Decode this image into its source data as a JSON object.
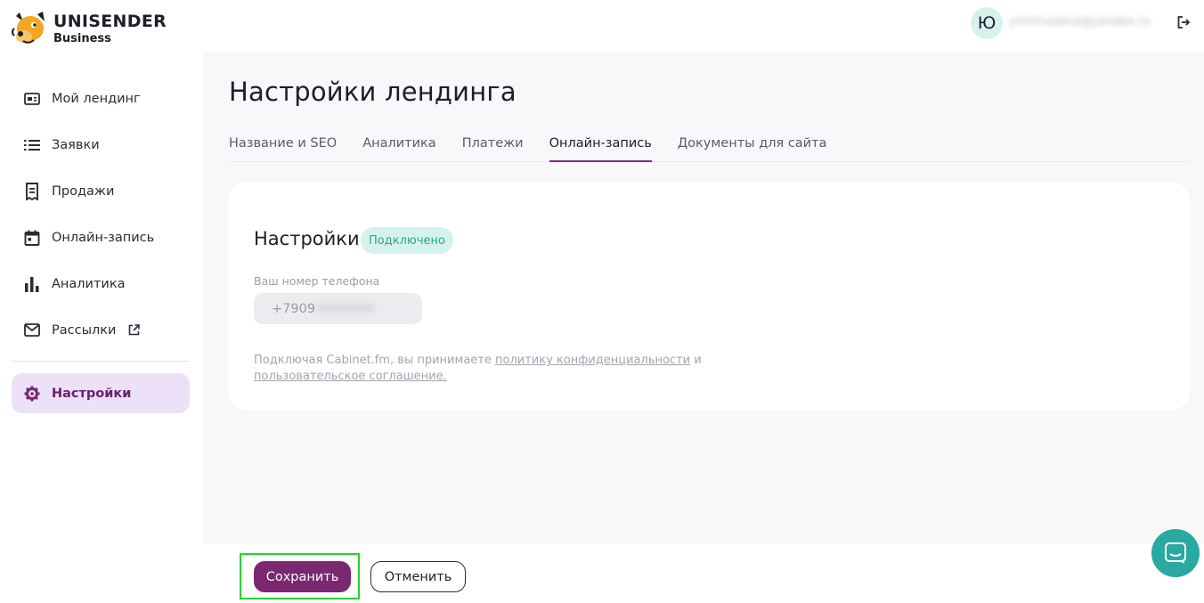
{
  "brand": {
    "name": "UNISENDER",
    "sub": "Business"
  },
  "sidebar": {
    "items": [
      {
        "label": "Мой лендинг",
        "icon": "landing-icon"
      },
      {
        "label": "Заявки",
        "icon": "list-icon"
      },
      {
        "label": "Продажи",
        "icon": "receipt-icon"
      },
      {
        "label": "Онлайн-запись",
        "icon": "calendar-icon"
      },
      {
        "label": "Аналитика",
        "icon": "bar-chart-icon"
      },
      {
        "label": "Рассылки",
        "icon": "mail-icon",
        "external": true
      },
      {
        "label": "Настройки",
        "icon": "gear-icon",
        "active": true
      }
    ]
  },
  "topbar": {
    "avatar_letter": "Ю",
    "email": "yrmrhuidera@yandex.ru"
  },
  "page": {
    "title": "Настройки лендинга",
    "tabs": [
      {
        "label": "Название и SEO"
      },
      {
        "label": "Аналитика"
      },
      {
        "label": "Платежи"
      },
      {
        "label": "Онлайн-запись",
        "active": true
      },
      {
        "label": "Документы для сайта"
      }
    ]
  },
  "card": {
    "title": "Настройки",
    "status_badge": "Подключено",
    "phone_label": "Ваш номер телефона",
    "phone_prefix": "+7909",
    "phone_hidden": "0000000",
    "legal_prefix": "Подключая Cabinet.fm, вы принимаете ",
    "privacy_link": "политику конфиденциальности",
    "legal_and": " и",
    "terms_link": "пользовательское соглашение."
  },
  "actions": {
    "save_label": "Сохранить",
    "cancel_label": "Отменить"
  },
  "colors": {
    "accent": "#7b2870",
    "active_nav_bg": "#ece1f9",
    "badge_bg": "#d6f2ec",
    "badge_text": "#2fa58a",
    "chat": "#2aa9a0",
    "highlight": "#23d42b"
  }
}
